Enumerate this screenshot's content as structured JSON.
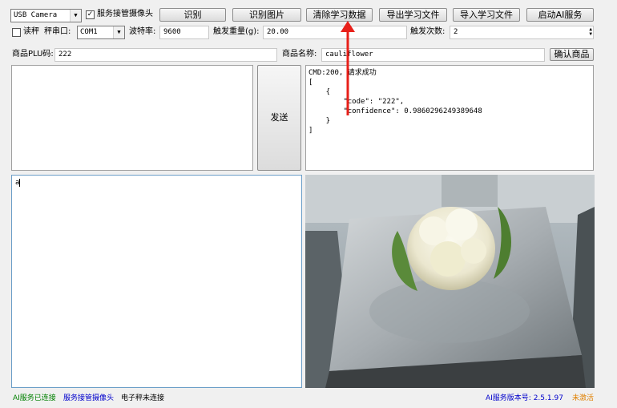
{
  "toolbar": {
    "camera_select": "USB Camera",
    "service_camera_label": "服务接管摄像头",
    "service_camera_checked": true,
    "buttons": [
      "识别",
      "识别图片",
      "清除学习数据",
      "导出学习文件",
      "导入学习文件",
      "启动AI服务"
    ]
  },
  "scale": {
    "scale_label": "读秤",
    "port_label": "秤串口:",
    "port_value": "COM1",
    "baud_label": "波特率:",
    "baud_value": "9600",
    "trigger_weight_label": "触发重量(g):",
    "trigger_weight_value": "20.00",
    "trigger_count_label": "触发次数:",
    "trigger_count_value": "2"
  },
  "product": {
    "plu_label": "商品PLU码:",
    "plu_value": "222",
    "name_label": "商品名称:",
    "name_value": "cauliflower",
    "confirm_button": "确认商品"
  },
  "send_button": "发送",
  "response": {
    "line1": "CMD:200, 请求成功",
    "line2": "[",
    "line3": "    {",
    "line4": "        \"code\": \"222\",",
    "line5": "        \"confidence\": 0.9860296249389648",
    "line6": "    }",
    "line7": "]"
  },
  "input_text": "a",
  "status": {
    "ai_connected": "AI服务已连接",
    "camera_service": "服务接管摄像头",
    "scale_status": "电子秤未连接",
    "version_label": "AI服务版本号: 2.5.1.97",
    "activation": "未激活",
    "colors": {
      "green": "#008000",
      "blue": "#0000cc",
      "orange": "#e08000"
    }
  }
}
